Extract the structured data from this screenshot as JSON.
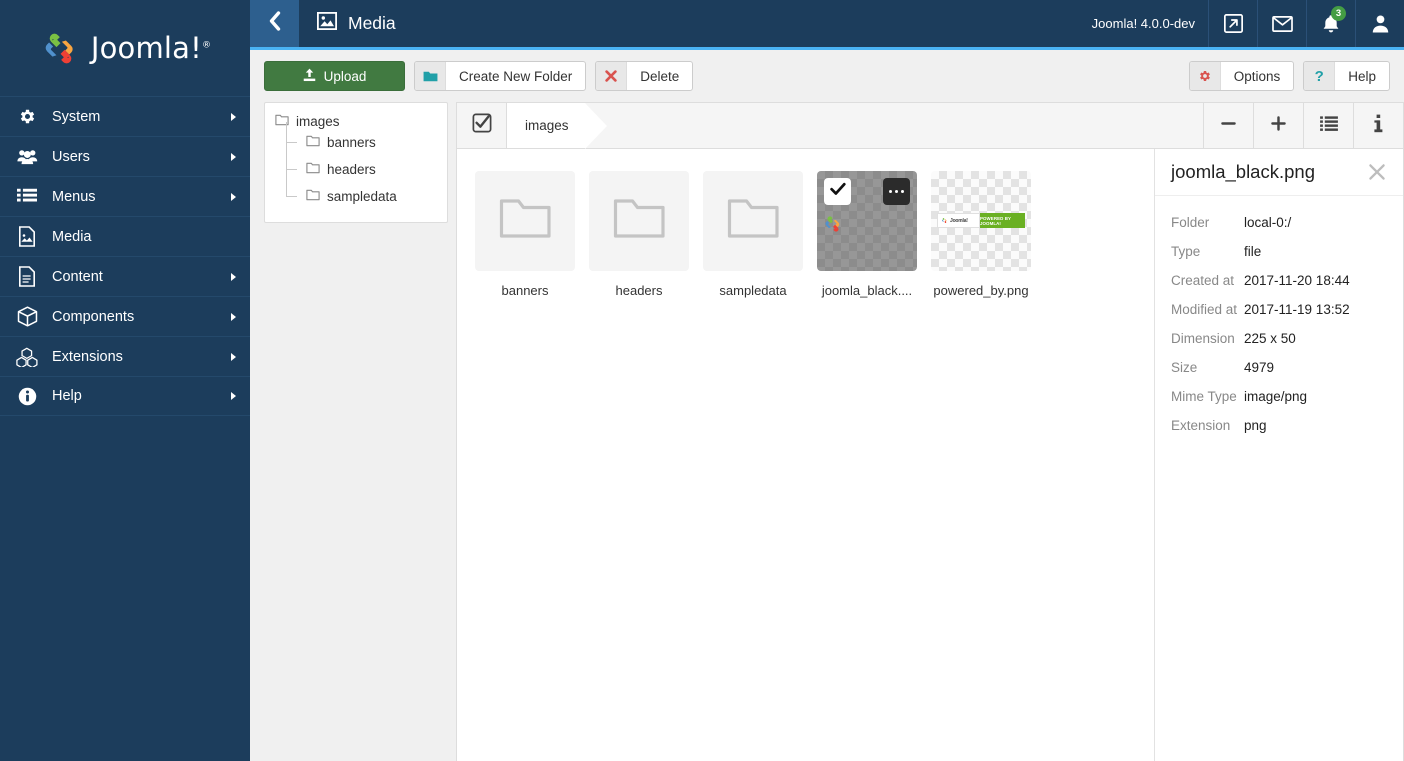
{
  "brand": {
    "name": "Joomla!",
    "trademark": "®",
    "logo_icon": "joomla-logo-icon"
  },
  "sidebar": {
    "items": [
      {
        "label": "System",
        "icon": "gear-icon",
        "has_submenu": true
      },
      {
        "label": "Users",
        "icon": "users-icon",
        "has_submenu": true
      },
      {
        "label": "Menus",
        "icon": "list-icon",
        "has_submenu": true
      },
      {
        "label": "Media",
        "icon": "image-file-icon",
        "has_submenu": false
      },
      {
        "label": "Content",
        "icon": "document-icon",
        "has_submenu": true
      },
      {
        "label": "Components",
        "icon": "cube-icon",
        "has_submenu": true
      },
      {
        "label": "Extensions",
        "icon": "blocks-icon",
        "has_submenu": true
      },
      {
        "label": "Help",
        "icon": "info-circle-icon",
        "has_submenu": true
      }
    ]
  },
  "header": {
    "back_icon": "chevron-left-icon",
    "page_icon": "image-icon",
    "title": "Media",
    "version": "Joomla! 4.0.0-dev",
    "icons": [
      {
        "name": "preview-site-icon",
        "badge": ""
      },
      {
        "name": "messages-icon",
        "badge": ""
      },
      {
        "name": "notifications-icon",
        "badge": "3"
      },
      {
        "name": "user-account-icon",
        "badge": ""
      }
    ],
    "badge_color": "#449d44",
    "accent_color": "#4ab3f4"
  },
  "toolbar": {
    "upload_label": "Upload",
    "upload_icon": "upload-icon",
    "upload_color": "#417a41",
    "create_folder_label": "Create New Folder",
    "create_folder_icon": "folder-icon",
    "delete_label": "Delete",
    "delete_icon": "close-x-icon",
    "options_label": "Options",
    "options_icon": "gear-icon",
    "help_label": "Help",
    "help_icon": "question-mark-icon"
  },
  "tree": {
    "root": {
      "label": "images",
      "icon": "folder-outline-icon"
    },
    "children": [
      {
        "label": "banners",
        "icon": "folder-outline-icon"
      },
      {
        "label": "headers",
        "icon": "folder-outline-icon"
      },
      {
        "label": "sampledata",
        "icon": "folder-outline-icon"
      }
    ]
  },
  "content_bar": {
    "select_all_icon": "checkbox-checked-icon",
    "breadcrumbs": [
      {
        "label": "images"
      }
    ],
    "buttons": [
      {
        "name": "zoom-out-button",
        "icon": "minus-icon"
      },
      {
        "name": "zoom-in-button",
        "icon": "plus-icon"
      },
      {
        "name": "toggle-list-view-button",
        "icon": "list-view-icon"
      },
      {
        "name": "toggle-info-button",
        "icon": "info-icon"
      }
    ]
  },
  "items": [
    {
      "label": "banners",
      "kind": "folder",
      "selected": false
    },
    {
      "label": "headers",
      "kind": "folder",
      "selected": false
    },
    {
      "label": "sampledata",
      "kind": "folder",
      "selected": false
    },
    {
      "label": "joomla_black....",
      "kind": "image-joomla",
      "selected": true
    },
    {
      "label": "powered_by.png",
      "kind": "image-powered",
      "selected": false
    }
  ],
  "selected_tile": {
    "check_icon": "check-icon",
    "menu_icon": "ellipsis-icon"
  },
  "powered_by_thumb": {
    "left_text": "Joomla!",
    "right_text": "POWERED BY JOOMLA!",
    "green": "#6ab023"
  },
  "info_panel": {
    "title": "joomla_black.png",
    "close_icon": "close-x-icon",
    "rows": [
      {
        "key": "Folder",
        "value": "local-0:/"
      },
      {
        "key": "Type",
        "value": "file"
      },
      {
        "key": "Created at",
        "value": "2017-11-20 18:44"
      },
      {
        "key": "Modified at",
        "value": "2017-11-19 13:52"
      },
      {
        "key": "Dimension",
        "value": "225 x 50"
      },
      {
        "key": "Size",
        "value": "4979"
      },
      {
        "key": "Mime Type",
        "value": "image/png"
      },
      {
        "key": "Extension",
        "value": "png"
      }
    ]
  }
}
